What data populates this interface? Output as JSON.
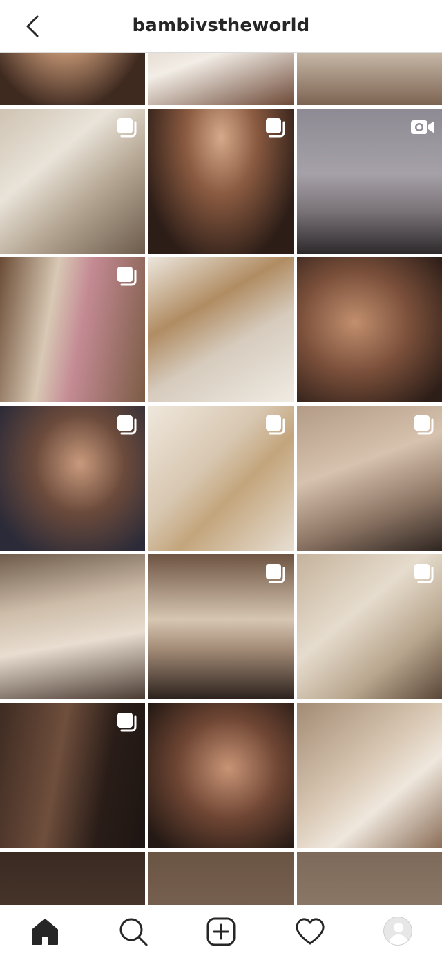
{
  "header": {
    "username": "bambivstheworld",
    "back_icon": "chevron-left-icon"
  },
  "grid": {
    "rows": [
      [
        {
          "badge": "none"
        },
        {
          "badge": "none"
        },
        {
          "badge": "none"
        }
      ],
      [
        {
          "badge": "carousel"
        },
        {
          "badge": "carousel"
        },
        {
          "badge": "video"
        }
      ],
      [
        {
          "badge": "carousel"
        },
        {
          "badge": "none"
        },
        {
          "badge": "none"
        }
      ],
      [
        {
          "badge": "carousel"
        },
        {
          "badge": "carousel"
        },
        {
          "badge": "carousel"
        }
      ],
      [
        {
          "badge": "none"
        },
        {
          "badge": "carousel"
        },
        {
          "badge": "carousel"
        }
      ],
      [
        {
          "badge": "carousel"
        },
        {
          "badge": "none"
        },
        {
          "badge": "none"
        }
      ],
      [
        {
          "badge": "none"
        },
        {
          "badge": "none"
        },
        {
          "badge": "none"
        }
      ]
    ]
  },
  "bottom_nav": {
    "items": [
      {
        "name": "home",
        "icon": "home-icon",
        "active": true
      },
      {
        "name": "search",
        "icon": "search-icon",
        "active": false
      },
      {
        "name": "new-post",
        "icon": "plus-square-icon",
        "active": false
      },
      {
        "name": "activity",
        "icon": "heart-icon",
        "active": false
      },
      {
        "name": "profile",
        "icon": "avatar-icon",
        "active": false
      }
    ]
  },
  "colors": {
    "text": "#262626",
    "divider": "#dbdbdb",
    "background": "#ffffff",
    "badge": "#ffffff"
  }
}
